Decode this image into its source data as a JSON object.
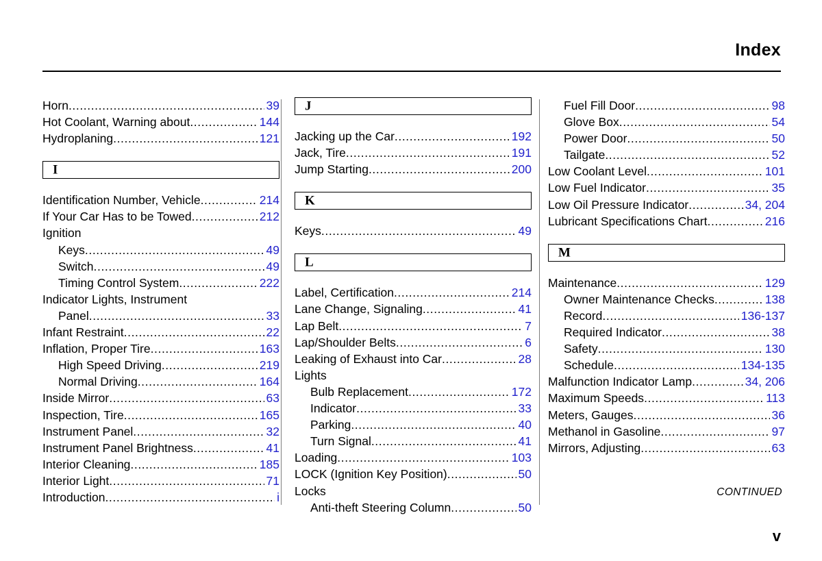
{
  "header": {
    "title": "Index"
  },
  "footer": {
    "continued": "CONTINUED",
    "page_number": "v"
  },
  "colors": {
    "page_number_blue": "#2222cc",
    "text_black": "#000000",
    "divider_gray": "#7d7d7d"
  },
  "columns": [
    {
      "id": "column-1",
      "blocks": [
        {
          "type": "entries",
          "entries": [
            {
              "label": "Horn",
              "page": "39",
              "indent": 0,
              "leader": true
            },
            {
              "label": "Hot Coolant, Warning about",
              "page": "144",
              "indent": 0,
              "leader": true
            },
            {
              "label": "Hydroplaning",
              "page": "121",
              "indent": 0,
              "leader": true
            }
          ]
        },
        {
          "type": "letter",
          "letter": "I"
        },
        {
          "type": "entries",
          "entries": [
            {
              "label": "Identification Number, Vehicle",
              "page": "214",
              "indent": 0,
              "leader": true
            },
            {
              "label": "If Your Car Has to be Towed",
              "page": "212",
              "indent": 0,
              "leader": true
            },
            {
              "label": "Ignition",
              "page": "",
              "indent": 0,
              "leader": false
            },
            {
              "label": "Keys",
              "page": "49",
              "indent": 1,
              "leader": true
            },
            {
              "label": "Switch",
              "page": "49",
              "indent": 1,
              "leader": true
            },
            {
              "label": "Timing Control System",
              "page": "222",
              "indent": 1,
              "leader": true
            },
            {
              "label": "Indicator Lights, Instrument",
              "page": "",
              "indent": 0,
              "leader": false
            },
            {
              "label": "Panel",
              "page": "33",
              "indent": 1,
              "leader": true
            },
            {
              "label": "Infant Restraint",
              "page": "22",
              "indent": 0,
              "leader": true
            },
            {
              "label": "Inflation, Proper Tire ",
              "page": "163",
              "indent": 0,
              "leader": true
            },
            {
              "label": "High Speed Driving",
              "page": "219",
              "indent": 1,
              "leader": true
            },
            {
              "label": "Normal Driving",
              "page": "164",
              "indent": 1,
              "leader": true
            },
            {
              "label": "Inside Mirror",
              "page": "63",
              "indent": 0,
              "leader": true
            },
            {
              "label": "Inspection, Tire",
              "page": "165",
              "indent": 0,
              "leader": true
            },
            {
              "label": "Instrument Panel",
              "page": "32",
              "indent": 0,
              "leader": true
            },
            {
              "label": "Instrument Panel Brightness",
              "page": "41",
              "indent": 0,
              "leader": true
            },
            {
              "label": "Interior Cleaning",
              "page": "185",
              "indent": 0,
              "leader": true
            },
            {
              "label": "Interior Light",
              "page": "71",
              "indent": 0,
              "leader": true
            },
            {
              "label": "Introduction",
              "page": "i",
              "indent": 0,
              "leader": true
            }
          ]
        }
      ]
    },
    {
      "id": "column-2",
      "blocks": [
        {
          "type": "letter",
          "letter": "J",
          "first": true
        },
        {
          "type": "entries",
          "entries": [
            {
              "label": "Jacking up the Car",
              "page": "192",
              "indent": 0,
              "leader": true
            },
            {
              "label": "Jack, Tire",
              "page": "191",
              "indent": 0,
              "leader": true
            },
            {
              "label": "Jump Starting",
              "page": "200",
              "indent": 0,
              "leader": true
            }
          ]
        },
        {
          "type": "letter",
          "letter": "K"
        },
        {
          "type": "entries",
          "entries": [
            {
              "label": "Keys",
              "page": "49",
              "indent": 0,
              "leader": true
            }
          ]
        },
        {
          "type": "letter",
          "letter": "L"
        },
        {
          "type": "entries",
          "entries": [
            {
              "label": "Label, Certification",
              "page": "214",
              "indent": 0,
              "leader": true
            },
            {
              "label": "Lane Change, Signaling",
              "page": "41",
              "indent": 0,
              "leader": true
            },
            {
              "label": "Lap Belt",
              "page": "7",
              "indent": 0,
              "leader": true
            },
            {
              "label": "Lap/Shoulder Belts",
              "page": "6",
              "indent": 0,
              "leader": true
            },
            {
              "label": "Leaking of Exhaust into Car",
              "page": "28",
              "indent": 0,
              "leader": true
            },
            {
              "label": "Lights",
              "page": "",
              "indent": 0,
              "leader": false
            },
            {
              "label": "Bulb Replacement",
              "page": "172",
              "indent": 1,
              "leader": true
            },
            {
              "label": "Indicator",
              "page": "33",
              "indent": 1,
              "leader": true
            },
            {
              "label": "Parking",
              "page": "40",
              "indent": 1,
              "leader": true
            },
            {
              "label": "Turn Signal",
              "page": "41",
              "indent": 1,
              "leader": true
            },
            {
              "label": "Loading",
              "page": "103",
              "indent": 0,
              "leader": true
            },
            {
              "label": "LOCK (Ignition Key Position)",
              "page": "50",
              "indent": 0,
              "leader": true
            },
            {
              "label": "Locks",
              "page": "",
              "indent": 0,
              "leader": false
            },
            {
              "label": "Anti-theft Steering Column",
              "page": "50",
              "indent": 1,
              "leader": true
            }
          ]
        }
      ]
    },
    {
      "id": "column-3",
      "blocks": [
        {
          "type": "entries",
          "entries": [
            {
              "label": "Fuel Fill Door",
              "page": "98",
              "indent": 1,
              "leader": true
            },
            {
              "label": "Glove Box",
              "page": "54",
              "indent": 1,
              "leader": true
            },
            {
              "label": "Power Door",
              "page": "50",
              "indent": 1,
              "leader": true
            },
            {
              "label": "Tailgate",
              "page": "52",
              "indent": 1,
              "leader": true
            },
            {
              "label": "Low Coolant Level",
              "page": "101",
              "indent": 0,
              "leader": true
            },
            {
              "label": "Low Fuel Indicator ",
              "page": "35",
              "indent": 0,
              "leader": true
            },
            {
              "label": "Low Oil Pressure Indicator",
              "page": "34, 204",
              "indent": 0,
              "leader": true
            },
            {
              "label": "Lubricant Specifications Chart",
              "page": "216",
              "indent": 0,
              "leader": true
            }
          ]
        },
        {
          "type": "letter",
          "letter": "M"
        },
        {
          "type": "entries",
          "entries": [
            {
              "label": "Maintenance",
              "page": "129",
              "indent": 0,
              "leader": true
            },
            {
              "label": "Owner Maintenance Checks",
              "page": "138",
              "indent": 1,
              "leader": true
            },
            {
              "label": "Record",
              "page": "136-137",
              "indent": 1,
              "leader": true
            },
            {
              "label": "Required Indicator",
              "page": "38",
              "indent": 1,
              "leader": true
            },
            {
              "label": "Safety",
              "page": "130",
              "indent": 1,
              "leader": true
            },
            {
              "label": "Schedule",
              "page": "134-135",
              "indent": 1,
              "leader": true
            },
            {
              "label": "Malfunction Indicator Lamp",
              "page": "34, 206",
              "indent": 0,
              "leader": true
            },
            {
              "label": "Maximum Speeds",
              "page": "113",
              "indent": 0,
              "leader": true
            },
            {
              "label": "Meters, Gauges",
              "page": "36",
              "indent": 0,
              "leader": true
            },
            {
              "label": "Methanol in Gasoline",
              "page": "97",
              "indent": 0,
              "leader": true
            },
            {
              "label": "Mirrors, Adjusting",
              "page": "63",
              "indent": 0,
              "leader": true
            }
          ]
        }
      ]
    }
  ]
}
